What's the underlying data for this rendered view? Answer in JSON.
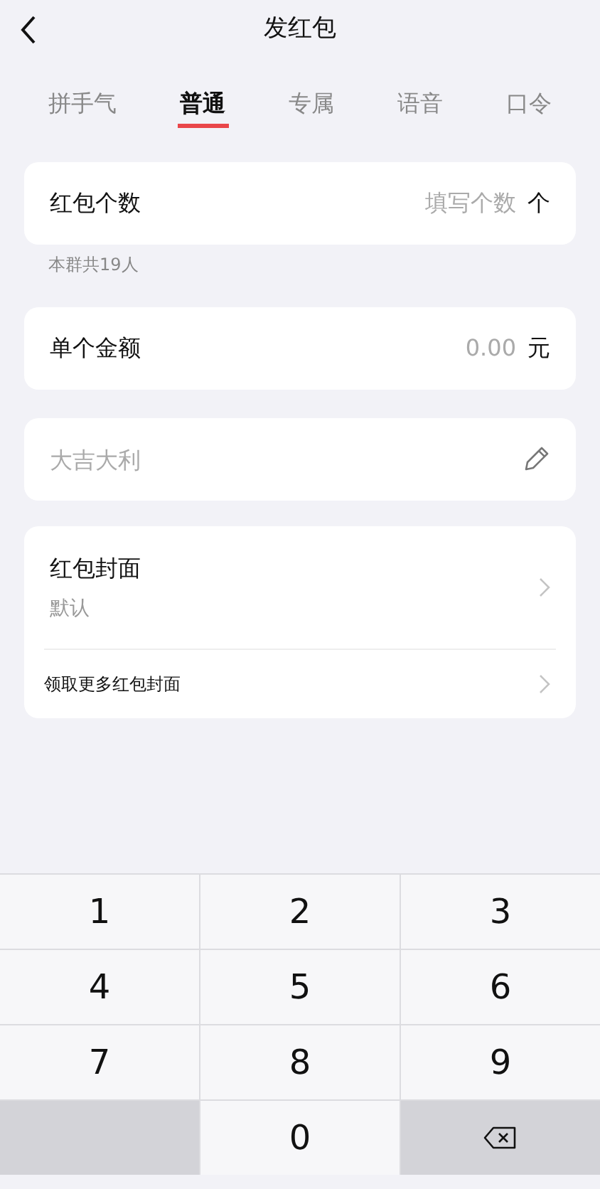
{
  "header": {
    "title": "发红包"
  },
  "tabs": [
    {
      "label": "拼手气",
      "selected": false
    },
    {
      "label": "普通",
      "selected": true
    },
    {
      "label": "专属",
      "selected": false
    },
    {
      "label": "语音",
      "selected": false
    },
    {
      "label": "口令",
      "selected": false
    }
  ],
  "count_row": {
    "label": "红包个数",
    "placeholder": "填写个数",
    "unit": "个"
  },
  "group_note": "本群共19人",
  "amount_row": {
    "label": "单个金额",
    "placeholder": "0.00",
    "unit": "元"
  },
  "greeting": {
    "placeholder": "大吉大利"
  },
  "cover": {
    "label": "红包封面",
    "value": "默认",
    "more_link": "领取更多红包封面"
  },
  "keypad": [
    {
      "kind": "digit",
      "label": "1"
    },
    {
      "kind": "digit",
      "label": "2"
    },
    {
      "kind": "digit",
      "label": "3"
    },
    {
      "kind": "digit",
      "label": "4"
    },
    {
      "kind": "digit",
      "label": "5"
    },
    {
      "kind": "digit",
      "label": "6"
    },
    {
      "kind": "digit",
      "label": "7"
    },
    {
      "kind": "digit",
      "label": "8"
    },
    {
      "kind": "digit",
      "label": "9"
    },
    {
      "kind": "blank"
    },
    {
      "kind": "digit",
      "label": "0"
    },
    {
      "kind": "delete"
    }
  ]
}
